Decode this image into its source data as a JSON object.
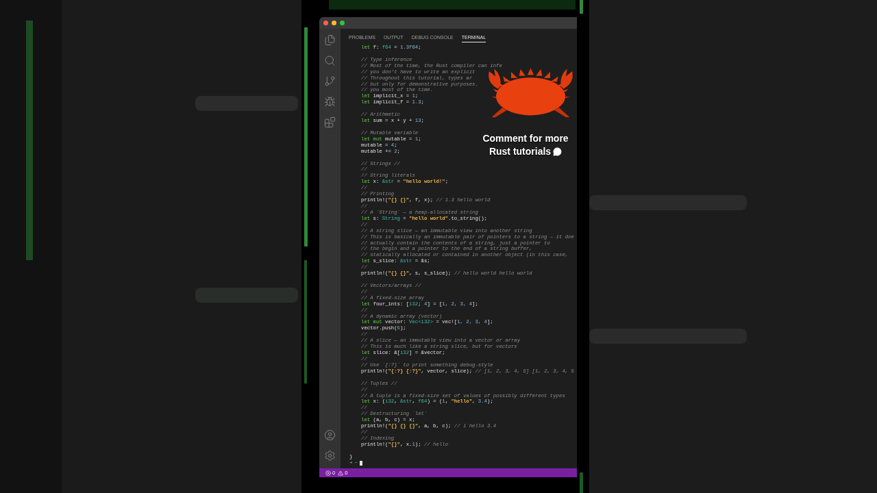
{
  "window": {
    "controls": [
      {
        "color": "#ff5f57"
      },
      {
        "color": "#febc2e"
      },
      {
        "color": "#28c840"
      }
    ]
  },
  "activity_bar": {
    "top": [
      {
        "kind": "files"
      },
      {
        "kind": "search"
      },
      {
        "kind": "source-control"
      },
      {
        "kind": "run-debug"
      },
      {
        "kind": "extensions"
      }
    ],
    "bottom": [
      {
        "kind": "account"
      },
      {
        "kind": "settings"
      }
    ]
  },
  "panel_tabs": [
    {
      "label": "PROBLEMS",
      "selected": false
    },
    {
      "label": "OUTPUT",
      "selected": false
    },
    {
      "label": "DEBUG CONSOLE",
      "selected": false
    },
    {
      "label": "TERMINAL",
      "selected": true
    }
  ],
  "terminal_lines": [
    {
      "kind": "code",
      "tokens": [
        {
          "kind": "kw",
          "text": "let"
        },
        {
          "kind": "plain",
          "text": " f: "
        },
        {
          "kind": "type",
          "text": "f64"
        },
        {
          "kind": "plain",
          "text": " = "
        },
        {
          "kind": "num",
          "text": "1.3f64"
        },
        {
          "kind": "plain",
          "text": ";"
        }
      ]
    },
    {
      "kind": "blank"
    },
    {
      "kind": "comment",
      "text": "// Type inference"
    },
    {
      "kind": "comment",
      "text": "// Most of the time, the Rust compiler can infe"
    },
    {
      "kind": "comment",
      "text": "// you don’t have to write an explicit"
    },
    {
      "kind": "comment",
      "text": "// Throughout this tutorial, types ar"
    },
    {
      "kind": "comment",
      "text": "// but only for demonstrative purposes."
    },
    {
      "kind": "comment",
      "text": "// you most of the time."
    },
    {
      "kind": "code",
      "tokens": [
        {
          "kind": "kw",
          "text": "let"
        },
        {
          "kind": "plain",
          "text": " implicit_x = "
        },
        {
          "kind": "num",
          "text": "1"
        },
        {
          "kind": "plain",
          "text": ";"
        }
      ]
    },
    {
      "kind": "code",
      "tokens": [
        {
          "kind": "kw",
          "text": "let"
        },
        {
          "kind": "plain",
          "text": " implicit_f = "
        },
        {
          "kind": "num",
          "text": "1.3"
        },
        {
          "kind": "plain",
          "text": ";"
        }
      ]
    },
    {
      "kind": "blank"
    },
    {
      "kind": "comment",
      "text": "// Arithmetic"
    },
    {
      "kind": "code",
      "tokens": [
        {
          "kind": "kw",
          "text": "let"
        },
        {
          "kind": "plain",
          "text": " sum = x + y + "
        },
        {
          "kind": "num",
          "text": "13"
        },
        {
          "kind": "plain",
          "text": ";"
        }
      ]
    },
    {
      "kind": "blank"
    },
    {
      "kind": "comment",
      "text": "// Mutable variable"
    },
    {
      "kind": "code",
      "tokens": [
        {
          "kind": "kw",
          "text": "let mut"
        },
        {
          "kind": "plain",
          "text": " mutable = "
        },
        {
          "kind": "num",
          "text": "1"
        },
        {
          "kind": "plain",
          "text": ";"
        }
      ]
    },
    {
      "kind": "code",
      "tokens": [
        {
          "kind": "plain",
          "text": "mutable = "
        },
        {
          "kind": "num",
          "text": "4"
        },
        {
          "kind": "plain",
          "text": ";"
        }
      ]
    },
    {
      "kind": "code",
      "tokens": [
        {
          "kind": "plain",
          "text": "mutable += "
        },
        {
          "kind": "num",
          "text": "2"
        },
        {
          "kind": "plain",
          "text": ";"
        }
      ]
    },
    {
      "kind": "blank"
    },
    {
      "kind": "comment",
      "text": "// Strings //"
    },
    {
      "kind": "comment",
      "text": "//"
    },
    {
      "kind": "comment",
      "text": "// String literals"
    },
    {
      "kind": "code",
      "tokens": [
        {
          "kind": "kw",
          "text": "let"
        },
        {
          "kind": "plain",
          "text": " x: "
        },
        {
          "kind": "type",
          "text": "&str"
        },
        {
          "kind": "plain",
          "text": " = "
        },
        {
          "kind": "str",
          "text": "\"hello world!\""
        },
        {
          "kind": "plain",
          "text": ";"
        }
      ]
    },
    {
      "kind": "comment",
      "text": "//"
    },
    {
      "kind": "comment",
      "text": "// Printing"
    },
    {
      "kind": "code",
      "tokens": [
        {
          "kind": "plain",
          "text": "println!("
        },
        {
          "kind": "str",
          "text": "\"{} {}\""
        },
        {
          "kind": "plain",
          "text": ", f, x); "
        },
        {
          "kind": "cmt",
          "text": "// 1.3 hello world"
        }
      ]
    },
    {
      "kind": "comment",
      "text": "//"
    },
    {
      "kind": "comment",
      "text": "// A `String` — a heap-allocated string"
    },
    {
      "kind": "code",
      "tokens": [
        {
          "kind": "kw",
          "text": "let"
        },
        {
          "kind": "plain",
          "text": " s: "
        },
        {
          "kind": "type",
          "text": "String"
        },
        {
          "kind": "plain",
          "text": " = "
        },
        {
          "kind": "str",
          "text": "\"hello world\""
        },
        {
          "kind": "plain",
          "text": ".to_string();"
        }
      ]
    },
    {
      "kind": "comment",
      "text": "//"
    },
    {
      "kind": "comment",
      "text": "// A string slice — an immutable view into another string"
    },
    {
      "kind": "comment",
      "text": "// This is basically an immutable pair of pointers to a string — it doe"
    },
    {
      "kind": "comment",
      "text": "// actually contain the contents of a string, just a pointer to"
    },
    {
      "kind": "comment",
      "text": "// the begin and a pointer to the end of a string buffer,"
    },
    {
      "kind": "comment",
      "text": "// statically allocated or contained in another object (in this case,"
    },
    {
      "kind": "code",
      "tokens": [
        {
          "kind": "kw",
          "text": "let"
        },
        {
          "kind": "plain",
          "text": " s_slice: "
        },
        {
          "kind": "type",
          "text": "&str"
        },
        {
          "kind": "plain",
          "text": " = &s;"
        }
      ]
    },
    {
      "kind": "comment",
      "text": "//"
    },
    {
      "kind": "code",
      "tokens": [
        {
          "kind": "plain",
          "text": "println!("
        },
        {
          "kind": "str",
          "text": "\"{} {}\""
        },
        {
          "kind": "plain",
          "text": ", s, s_slice); "
        },
        {
          "kind": "cmt",
          "text": "// hello world hello world"
        }
      ]
    },
    {
      "kind": "blank"
    },
    {
      "kind": "comment",
      "text": "// Vectors/arrays //"
    },
    {
      "kind": "comment",
      "text": "//"
    },
    {
      "kind": "comment",
      "text": "// A fixed-size array"
    },
    {
      "kind": "code",
      "tokens": [
        {
          "kind": "kw",
          "text": "let"
        },
        {
          "kind": "plain",
          "text": " four_ints: ["
        },
        {
          "kind": "type",
          "text": "i32"
        },
        {
          "kind": "plain",
          "text": "; "
        },
        {
          "kind": "num",
          "text": "4"
        },
        {
          "kind": "plain",
          "text": "] = ["
        },
        {
          "kind": "num",
          "text": "1, 2, 3, 4"
        },
        {
          "kind": "plain",
          "text": "];"
        }
      ]
    },
    {
      "kind": "comment",
      "text": "//"
    },
    {
      "kind": "comment",
      "text": "// A dynamic array (vector)"
    },
    {
      "kind": "code",
      "tokens": [
        {
          "kind": "kw",
          "text": "let mut"
        },
        {
          "kind": "plain",
          "text": " vector: "
        },
        {
          "kind": "type",
          "text": "Vec<i32>"
        },
        {
          "kind": "plain",
          "text": " = vec!["
        },
        {
          "kind": "num",
          "text": "1, 2, 3, 4"
        },
        {
          "kind": "plain",
          "text": "];"
        }
      ]
    },
    {
      "kind": "code",
      "tokens": [
        {
          "kind": "plain",
          "text": "vector.push("
        },
        {
          "kind": "num",
          "text": "5"
        },
        {
          "kind": "plain",
          "text": ");"
        }
      ]
    },
    {
      "kind": "comment",
      "text": "//"
    },
    {
      "kind": "comment",
      "text": "// A slice — an immutable view into a vector or array"
    },
    {
      "kind": "comment",
      "text": "// This is much like a string slice, but for vectors"
    },
    {
      "kind": "code",
      "tokens": [
        {
          "kind": "kw",
          "text": "let"
        },
        {
          "kind": "plain",
          "text": " slice: &["
        },
        {
          "kind": "type",
          "text": "i32"
        },
        {
          "kind": "plain",
          "text": "] = &vector;"
        }
      ]
    },
    {
      "kind": "comment",
      "text": "//"
    },
    {
      "kind": "comment",
      "text": "// Use `{:?}` to print something debug-style"
    },
    {
      "kind": "code",
      "tokens": [
        {
          "kind": "plain",
          "text": "println!("
        },
        {
          "kind": "str",
          "text": "\"{:?} {:?}\""
        },
        {
          "kind": "plain",
          "text": ", vector, slice); "
        },
        {
          "kind": "cmt",
          "text": "// [1, 2, 3, 4, 5] [1, 2, 3, 4, 5"
        }
      ]
    },
    {
      "kind": "blank"
    },
    {
      "kind": "comment",
      "text": "// Tuples //"
    },
    {
      "kind": "comment",
      "text": "//"
    },
    {
      "kind": "comment",
      "text": "// A tuple is a fixed-size set of values of possibly different types"
    },
    {
      "kind": "code",
      "tokens": [
        {
          "kind": "kw",
          "text": "let"
        },
        {
          "kind": "plain",
          "text": " x: ("
        },
        {
          "kind": "type",
          "text": "i32"
        },
        {
          "kind": "plain",
          "text": ", "
        },
        {
          "kind": "type",
          "text": "&str"
        },
        {
          "kind": "plain",
          "text": ", "
        },
        {
          "kind": "type",
          "text": "f64"
        },
        {
          "kind": "plain",
          "text": ") = ("
        },
        {
          "kind": "num",
          "text": "1"
        },
        {
          "kind": "plain",
          "text": ", "
        },
        {
          "kind": "str",
          "text": "\"hello\""
        },
        {
          "kind": "plain",
          "text": ", "
        },
        {
          "kind": "num",
          "text": "3.4"
        },
        {
          "kind": "plain",
          "text": ");"
        }
      ]
    },
    {
      "kind": "comment",
      "text": "//"
    },
    {
      "kind": "comment",
      "text": "// Destructuring `let`"
    },
    {
      "kind": "code",
      "tokens": [
        {
          "kind": "kw",
          "text": "let"
        },
        {
          "kind": "plain",
          "text": " (a, b, c) = x;"
        }
      ]
    },
    {
      "kind": "code",
      "tokens": [
        {
          "kind": "plain",
          "text": "println!("
        },
        {
          "kind": "str",
          "text": "\"{} {} {}\""
        },
        {
          "kind": "plain",
          "text": ", a, b, c); "
        },
        {
          "kind": "cmt",
          "text": "// 1 hello 3.4"
        }
      ]
    },
    {
      "kind": "comment",
      "text": "//"
    },
    {
      "kind": "comment",
      "text": "// Indexing"
    },
    {
      "kind": "code",
      "tokens": [
        {
          "kind": "plain",
          "text": "println!("
        },
        {
          "kind": "str",
          "text": "\"{}\""
        },
        {
          "kind": "plain",
          "text": ", x."
        },
        {
          "kind": "num",
          "text": "1"
        },
        {
          "kind": "plain",
          "text": "); "
        },
        {
          "kind": "cmt",
          "text": "// hello"
        }
      ]
    },
    {
      "kind": "blank"
    },
    {
      "kind": "brace",
      "text": "}"
    },
    {
      "kind": "prompt",
      "arrow": "➜",
      "path": "~"
    }
  ],
  "overlay": {
    "mascot": {
      "kind": "crab"
    },
    "caption": [
      "Comment for more",
      "Rust tutorials"
    ]
  },
  "status_bar": {
    "errors": "0",
    "warnings": "0"
  }
}
